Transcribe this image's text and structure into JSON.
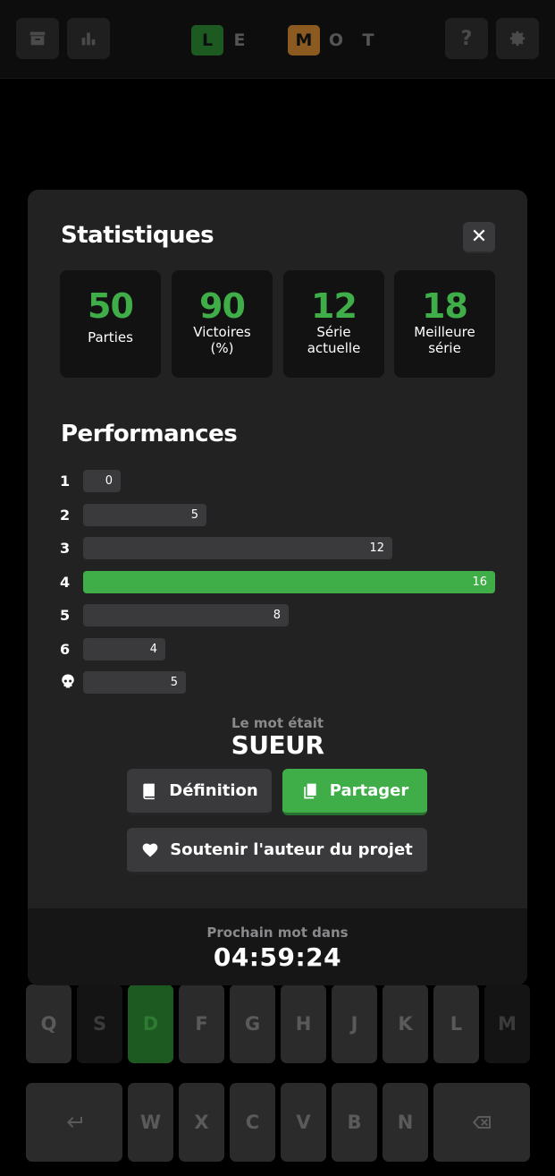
{
  "header": {
    "logo_letters": [
      "L",
      "E",
      "",
      "M",
      "O",
      "T"
    ],
    "help_label": "?"
  },
  "keyboard": {
    "row1": [
      "Q",
      "S",
      "D",
      "F",
      "G",
      "H",
      "J",
      "K",
      "L",
      "M"
    ],
    "row2": [
      "W",
      "X",
      "C",
      "V",
      "B",
      "N"
    ]
  },
  "stats": {
    "title": "Statistiques",
    "close_label": "✕",
    "items": [
      {
        "value": "50",
        "label": "Parties"
      },
      {
        "value": "90",
        "label": "Victoires (%)"
      },
      {
        "value": "12",
        "label": "Série actuelle"
      },
      {
        "value": "18",
        "label": "Meilleure série"
      }
    ]
  },
  "performance": {
    "title": "Performances",
    "rows": [
      {
        "label": "1",
        "value": "0"
      },
      {
        "label": "2",
        "value": "5"
      },
      {
        "label": "3",
        "value": "12"
      },
      {
        "label": "4",
        "value": "16"
      },
      {
        "label": "5",
        "value": "8"
      },
      {
        "label": "6",
        "value": "4"
      },
      {
        "label": "",
        "value": "5"
      }
    ]
  },
  "result": {
    "label": "Le mot était",
    "word": "SUEUR"
  },
  "actions": {
    "definition": "Définition",
    "share": "Partager",
    "support": "Soutenir l'auteur du projet"
  },
  "next": {
    "label": "Prochain mot dans",
    "time": "04:59:24"
  },
  "colors": {
    "accent": "#3fae49",
    "bar": "#3a3a3c",
    "modal_bg": "#222223"
  }
}
